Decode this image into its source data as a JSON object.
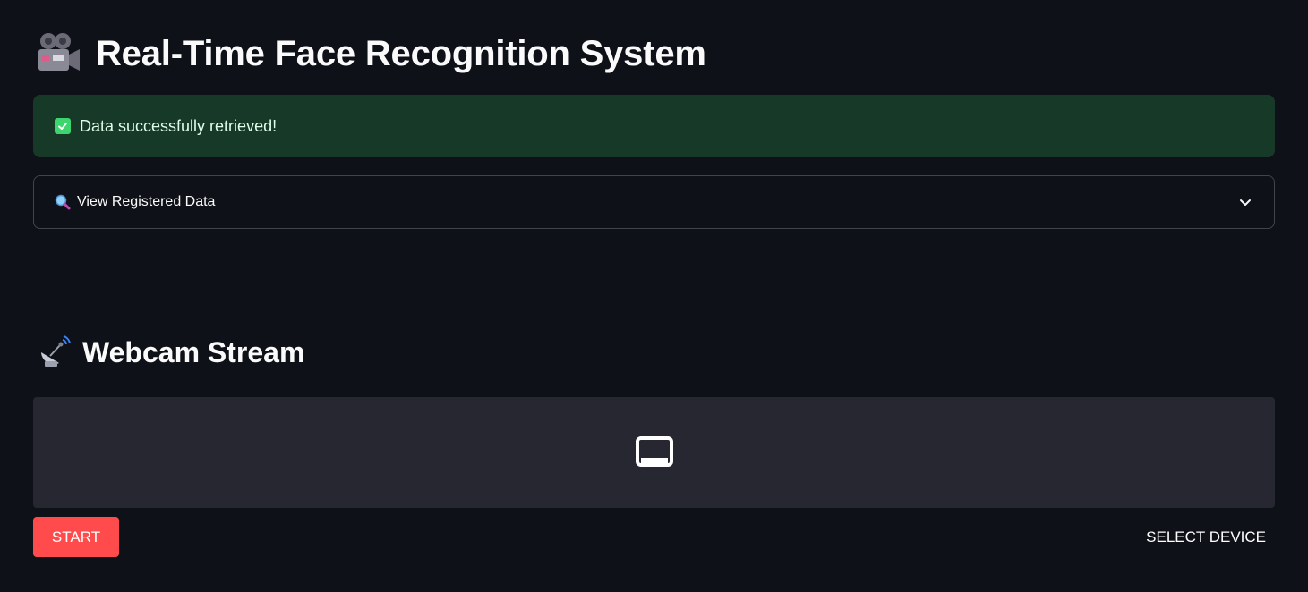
{
  "header": {
    "title": "Real-Time Face Recognition System",
    "icon": "movie-camera-icon"
  },
  "alert": {
    "text": "Data successfully retrieved!",
    "icon": "check-mark-icon",
    "color": "#3dd56d"
  },
  "expander": {
    "label": "View Registered Data",
    "icon": "magnifier-icon"
  },
  "stream": {
    "title": "Webcam Stream",
    "icon": "satellite-antenna-icon"
  },
  "controls": {
    "start_label": "START",
    "select_device_label": "SELECT DEVICE"
  },
  "colors": {
    "background": "#0e1117",
    "accent": "#ff4b4b",
    "alert_bg": "#173928",
    "video_bg": "#262730"
  }
}
